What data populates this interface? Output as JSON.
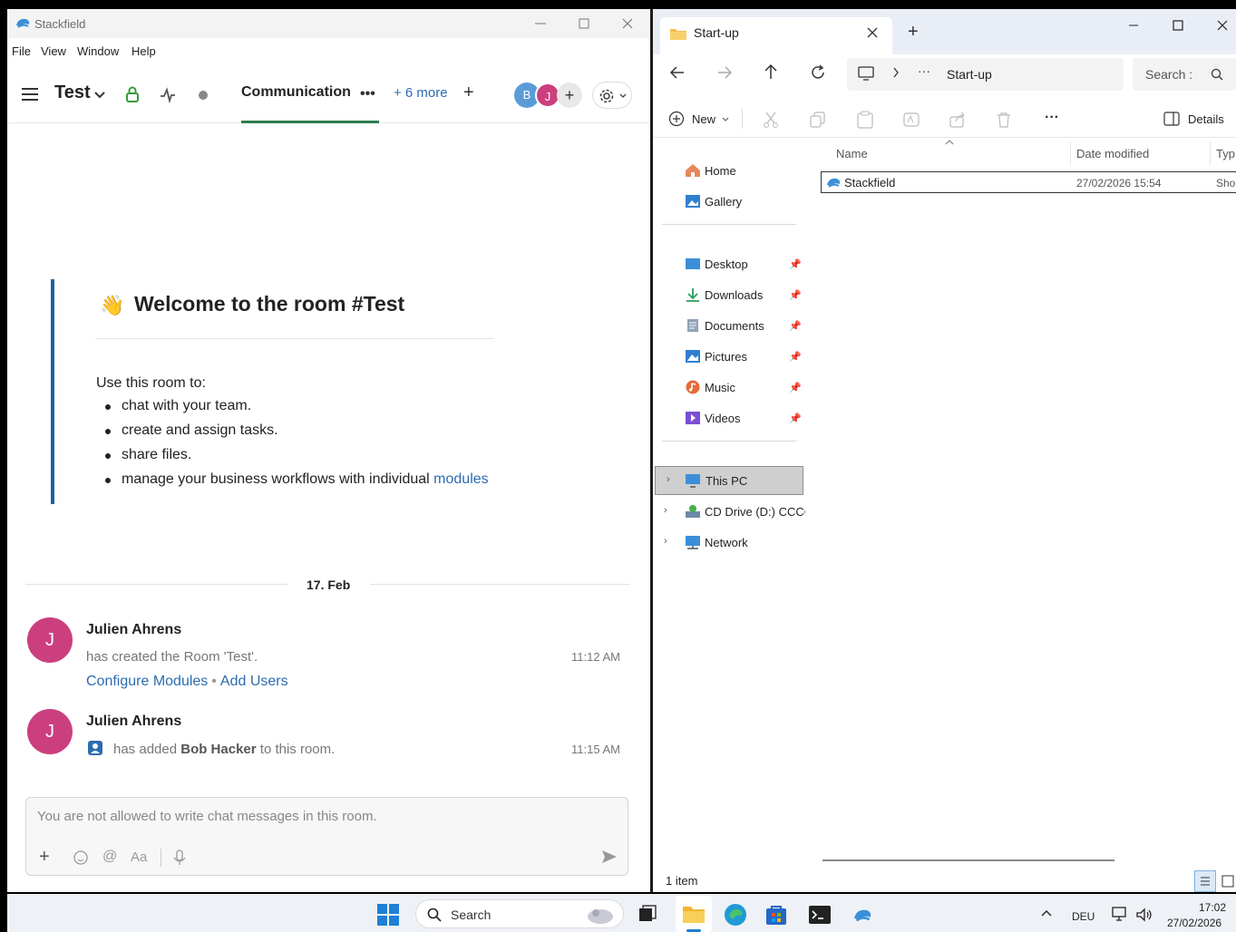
{
  "stackfield": {
    "window_title": "Stackfield",
    "menu": [
      "File",
      "View",
      "Window",
      "Help"
    ],
    "room_name": "Test",
    "tab_label": "Communication",
    "more_tabs": "+ 6 more",
    "members": [
      {
        "initial": "B",
        "color": "#5b9bd8"
      },
      {
        "initial": "J",
        "color": "#cc3f7e"
      }
    ],
    "welcome": {
      "title": "Welcome to the room #Test",
      "intro": "Use this room to:",
      "items": [
        "chat with your team.",
        "create and assign tasks.",
        "share files."
      ],
      "last_item_prefix": "manage your business workflows with individual ",
      "last_item_link": "modules"
    },
    "date_separator": "17. Feb",
    "messages": [
      {
        "avatar": "J",
        "author": "Julien Ahrens",
        "text": "has created the Room 'Test'.",
        "time": "11:12 AM",
        "link1": "Configure Modules",
        "link2": "Add Users"
      },
      {
        "avatar": "J",
        "author": "Julien Ahrens",
        "text_prefix": "has added ",
        "text_bold": "Bob Hacker",
        "text_suffix": " to this room.",
        "time": "11:15 AM"
      }
    ],
    "composer_placeholder": "You are not allowed to write chat messages in this room."
  },
  "explorer": {
    "tab_title": "Start-up",
    "address_current": "Start-up",
    "search_placeholder": "Search :",
    "new_label": "New",
    "details_label": "Details",
    "nav_top": [
      {
        "label": "Home",
        "icon": "home-icon"
      },
      {
        "label": "Gallery",
        "icon": "gallery-icon"
      }
    ],
    "nav_pinned": [
      {
        "label": "Desktop",
        "icon": "desktop-icon"
      },
      {
        "label": "Downloads",
        "icon": "downloads-icon"
      },
      {
        "label": "Documents",
        "icon": "documents-icon"
      },
      {
        "label": "Pictures",
        "icon": "pictures-icon"
      },
      {
        "label": "Music",
        "icon": "music-icon"
      },
      {
        "label": "Videos",
        "icon": "videos-icon"
      }
    ],
    "nav_bottom": [
      {
        "label": "This PC",
        "icon": "this-pc-icon"
      },
      {
        "label": "CD Drive (D:) CCCC",
        "icon": "cd-drive-icon"
      },
      {
        "label": "Network",
        "icon": "network-icon"
      }
    ],
    "columns": {
      "name": "Name",
      "date": "Date modified",
      "type": "Typ"
    },
    "files": [
      {
        "name": "Stackfield",
        "date": "27/02/2026 15:54",
        "type": "Sho"
      }
    ],
    "status": "1 item"
  },
  "taskbar": {
    "search_label": "Search",
    "language": "DEU",
    "time": "17:02",
    "date": "27/02/2026"
  },
  "colors": {
    "accent_green": "#2e7d4f",
    "link_blue": "#2c6cb0",
    "quote_bar": "#1e5fa8",
    "avatar_pink": "#cc3f7e"
  }
}
